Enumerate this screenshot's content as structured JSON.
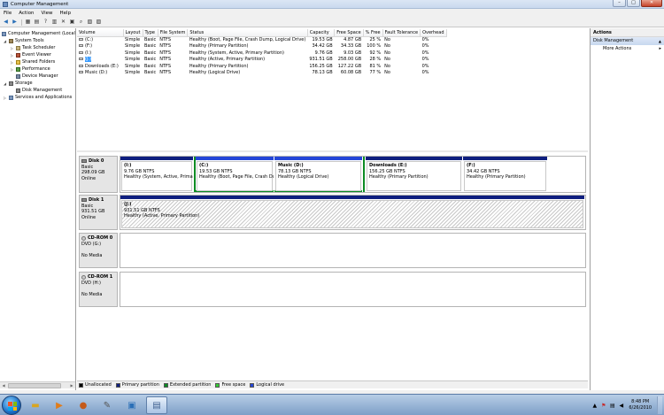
{
  "window": {
    "title": "Computer Management"
  },
  "menu": [
    "File",
    "Action",
    "View",
    "Help"
  ],
  "tree": {
    "root": "Computer Management (Local",
    "system_tools": "System Tools",
    "task_scheduler": "Task Scheduler",
    "event_viewer": "Event Viewer",
    "shared_folders": "Shared Folders",
    "performance": "Performance",
    "device_manager": "Device Manager",
    "storage": "Storage",
    "disk_management": "Disk Management",
    "services": "Services and Applications"
  },
  "volumes": {
    "columns": [
      "Volume",
      "Layout",
      "Type",
      "File System",
      "Status",
      "Capacity",
      "Free Space",
      "% Free",
      "Fault Tolerance",
      "Overhead"
    ],
    "rows": [
      [
        "(C:)",
        "Simple",
        "Basic",
        "NTFS",
        "Healthy (Boot, Page File, Crash Dump, Logical Drive)",
        "19.53 GB",
        "4.87 GB",
        "25 %",
        "No",
        "0%"
      ],
      [
        "(F:)",
        "Simple",
        "Basic",
        "NTFS",
        "Healthy (Primary Partition)",
        "34.42 GB",
        "34.33 GB",
        "100 %",
        "No",
        "0%"
      ],
      [
        "(I:)",
        "Simple",
        "Basic",
        "NTFS",
        "Healthy (System, Active, Primary Partition)",
        "9.76 GB",
        "9.03 GB",
        "92 %",
        "No",
        "0%"
      ],
      [
        "(J:)",
        "Simple",
        "Basic",
        "NTFS",
        "Healthy (Active, Primary Partition)",
        "931.51 GB",
        "258.00 GB",
        "28 %",
        "No",
        "0%"
      ],
      [
        "Downloads (E:)",
        "Simple",
        "Basic",
        "NTFS",
        "Healthy (Primary Partition)",
        "156.25 GB",
        "127.22 GB",
        "81 %",
        "No",
        "0%"
      ],
      [
        "Music (D:)",
        "Simple",
        "Basic",
        "NTFS",
        "Healthy (Logical Drive)",
        "78.13 GB",
        "60.08 GB",
        "77 %",
        "No",
        "0%"
      ]
    ]
  },
  "disks": {
    "disk0": {
      "name": "Disk 0",
      "type": "Basic",
      "size": "298.09 GB",
      "status": "Online",
      "parts": [
        {
          "name": "(I:)",
          "size": "9.76 GB NTFS",
          "status": "Healthy (System, Active, Primary"
        },
        {
          "name": "(C:)",
          "size": "19.53 GB NTFS",
          "status": "Healthy (Boot, Page File, Crash Dur"
        },
        {
          "name": "Music (D:)",
          "size": "78.13 GB NTFS",
          "status": "Healthy (Logical Drive)"
        },
        {
          "name": "Downloads (E:)",
          "size": "156.25 GB NTFS",
          "status": "Healthy (Primary Partition)"
        },
        {
          "name": "(F:)",
          "size": "34.42 GB NTFS",
          "status": "Healthy (Primary Partition)"
        }
      ]
    },
    "disk1": {
      "name": "Disk 1",
      "type": "Basic",
      "size": "931.51 GB",
      "status": "Online",
      "part": {
        "name": "(J:)",
        "size": "931.51 GB NTFS",
        "status": "Healthy (Active, Primary Partition)"
      }
    },
    "cdrom0": {
      "name": "CD-ROM 0",
      "type": "DVD (G:)",
      "status": "No Media"
    },
    "cdrom1": {
      "name": "CD-ROM 1",
      "type": "DVD (H:)",
      "status": "No Media"
    }
  },
  "legend": [
    {
      "label": "Unallocated",
      "color": "#000000"
    },
    {
      "label": "Primary partition",
      "color": "#0f1f7f"
    },
    {
      "label": "Extended partition",
      "color": "#0c8c23"
    },
    {
      "label": "Free space",
      "color": "#33cc33"
    },
    {
      "label": "Logical drive",
      "color": "#2446d8"
    }
  ],
  "actions": {
    "header": "Actions",
    "section": "Disk Management",
    "more": "More Actions"
  },
  "clock": {
    "time": "8:48 PM",
    "date": "6/26/2010"
  }
}
